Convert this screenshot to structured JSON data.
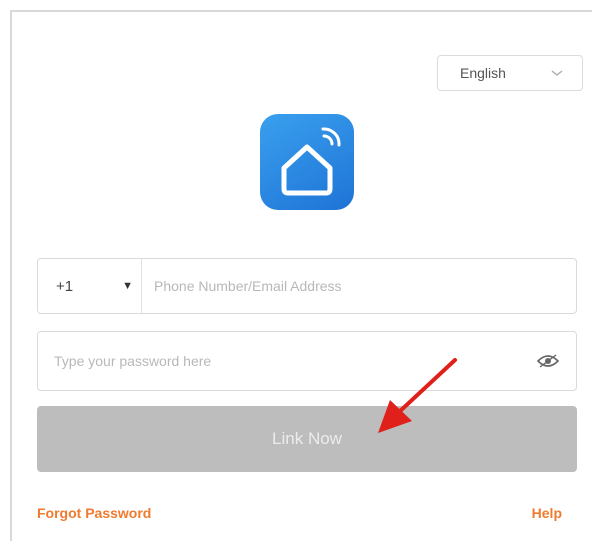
{
  "language_selector": {
    "value": "English",
    "icon": "chevron-down-icon"
  },
  "logo": {
    "icon": "smart-home-icon",
    "gradient": [
      "#3aa0ee",
      "#1e73d6"
    ]
  },
  "account": {
    "country_code": "+1",
    "placeholder": "Phone Number/Email Address"
  },
  "password": {
    "placeholder": "Type your password here",
    "toggle_icon": "eye-icon"
  },
  "submit": {
    "label": "Link Now"
  },
  "links": {
    "forgot": "Forgot Password",
    "help": "Help"
  },
  "colors": {
    "link": "#f07a2e",
    "button": "#bdbdbd",
    "annotation_arrow": "#e0201b"
  }
}
